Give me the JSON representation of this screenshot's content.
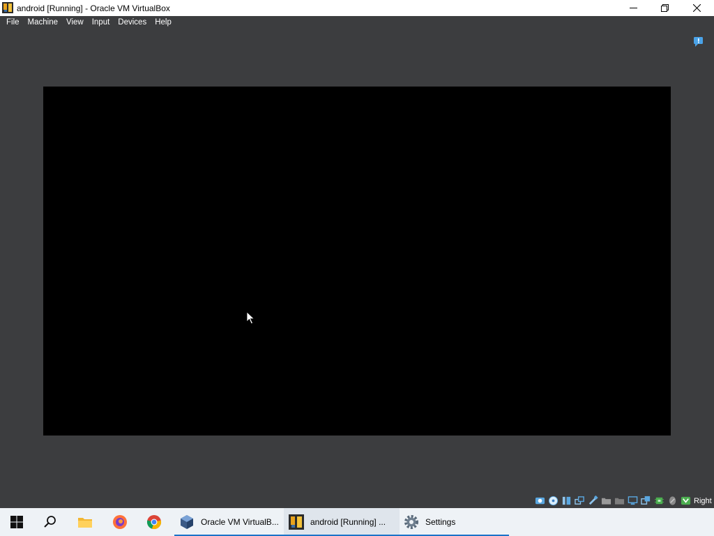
{
  "window": {
    "title": "android [Running] - Oracle VM VirtualBox"
  },
  "menu": {
    "items": [
      "File",
      "Machine",
      "View",
      "Input",
      "Devices",
      "Help"
    ]
  },
  "statusbar": {
    "icons": [
      "hard-disk-icon",
      "optical-drive-icon",
      "audio-icon",
      "network-icon",
      "usb-icon",
      "shared-folders-icon",
      "display-icon",
      "recording-icon",
      "cpu-icon",
      "mouse-integration-icon",
      "keyboard-icon"
    ],
    "host_key": "Right Ctrl"
  },
  "taskbar": {
    "apps": [
      {
        "label": "Oracle VM VirtualB..."
      },
      {
        "label": "android [Running] ..."
      },
      {
        "label": "Settings"
      }
    ]
  },
  "colors": {
    "accent": "#1a73c8",
    "vm_bg": "#3c3d3f",
    "screen": "#000000"
  }
}
